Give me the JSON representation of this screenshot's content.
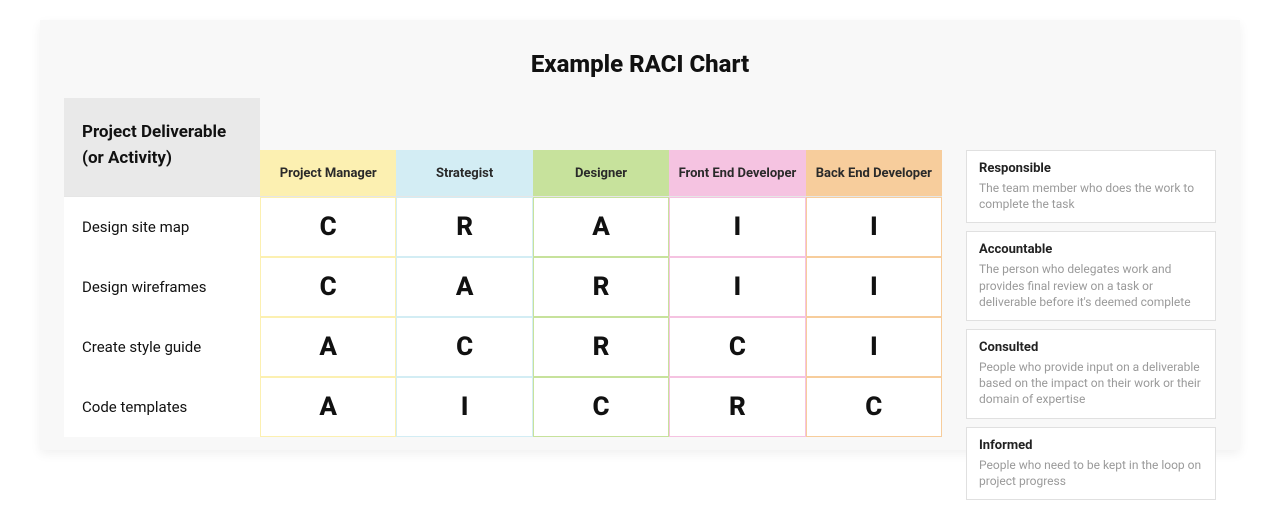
{
  "title": "Example RACI Chart",
  "row_header_label": "Project Deliverable (or Activity)",
  "columns": [
    "Project Manager",
    "Strategist",
    "Designer",
    "Front End Developer",
    "Back End Developer"
  ],
  "rows": [
    {
      "label": "Design site map",
      "cells": [
        "C",
        "R",
        "A",
        "I",
        "I"
      ]
    },
    {
      "label": "Design wireframes",
      "cells": [
        "C",
        "A",
        "R",
        "I",
        "I"
      ]
    },
    {
      "label": "Create style guide",
      "cells": [
        "A",
        "C",
        "R",
        "C",
        "I"
      ]
    },
    {
      "label": "Code templates",
      "cells": [
        "A",
        "I",
        "C",
        "R",
        "C"
      ]
    }
  ],
  "legend": [
    {
      "term": "Responsible",
      "desc": "The team member who does the work to complete the task"
    },
    {
      "term": "Accountable",
      "desc": "The person who delegates work and provides final review on a task or deliverable before it's deemed complete"
    },
    {
      "term": "Consulted",
      "desc": "People who provide input on a deliverable based on the impact on their work or their domain of expertise"
    },
    {
      "term": "Informed",
      "desc": "People who need to be kept in the loop on project progress"
    }
  ],
  "chart_data": {
    "type": "table",
    "title": "Example RACI Chart",
    "row_dimension": "Project Deliverable (or Activity)",
    "columns": [
      "Project Manager",
      "Strategist",
      "Designer",
      "Front End Developer",
      "Back End Developer"
    ],
    "rows": [
      "Design site map",
      "Design wireframes",
      "Create style guide",
      "Code templates"
    ],
    "values": [
      [
        "C",
        "R",
        "A",
        "I",
        "I"
      ],
      [
        "C",
        "A",
        "R",
        "I",
        "I"
      ],
      [
        "A",
        "C",
        "R",
        "C",
        "I"
      ],
      [
        "A",
        "I",
        "C",
        "R",
        "C"
      ]
    ],
    "code_meanings": {
      "R": "Responsible",
      "A": "Accountable",
      "C": "Consulted",
      "I": "Informed"
    }
  }
}
